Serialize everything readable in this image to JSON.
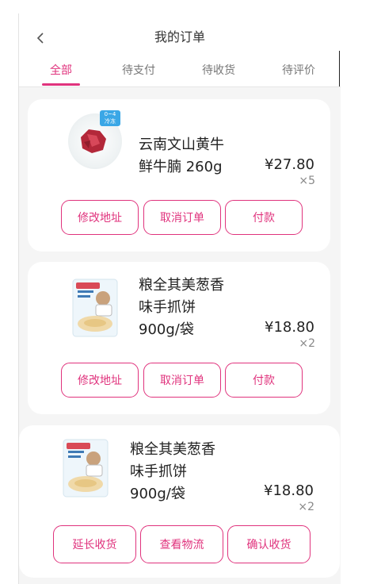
{
  "header": {
    "title": "我的订单"
  },
  "tabs": [
    {
      "label": "全部",
      "active": true
    },
    {
      "label": "待支付"
    },
    {
      "label": "待收货"
    },
    {
      "label": "待评价"
    }
  ],
  "orders": [
    {
      "name": "云南文山黄牛\n鲜牛腩 260g",
      "price": "¥27.80",
      "qty": "×5",
      "badge": "0~4\n冷冻",
      "actions": [
        "修改地址",
        "取消订单",
        "付款"
      ]
    },
    {
      "name": "粮全其美葱香\n味手抓饼\n900g/袋",
      "price": "¥18.80",
      "qty": "×2",
      "actions": [
        "修改地址",
        "取消订单",
        "付款"
      ]
    },
    {
      "name": "粮全其美葱香\n味手抓饼\n900g/袋",
      "price": "¥18.80",
      "qty": "×2",
      "actions": [
        "延长收货",
        "查看物流",
        "确认收货"
      ]
    }
  ],
  "colors": {
    "accent": "#e0337d",
    "background": "#f5f5f5"
  },
  "icons": {
    "back": "chevron-left-icon"
  }
}
